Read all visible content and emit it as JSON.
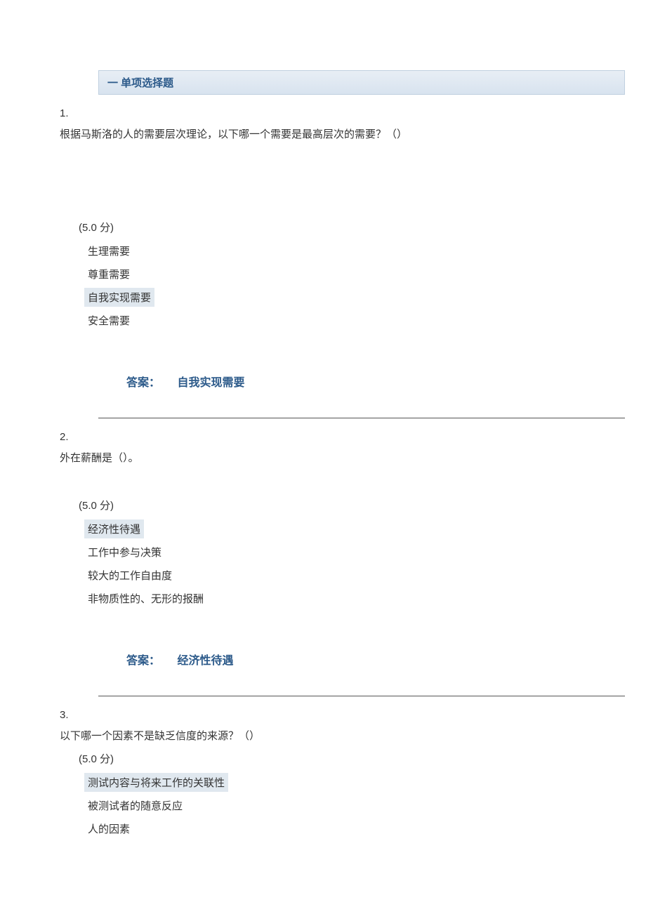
{
  "section_header": "一  单项选择题",
  "questions": [
    {
      "number": "1.",
      "text": "根据马斯洛的人的需要层次理论，以下哪一个需要是最高层次的需要？（）",
      "points": "(5.0  分)",
      "options": [
        {
          "text": "生理需要",
          "highlighted": false
        },
        {
          "text": "尊重需要",
          "highlighted": false
        },
        {
          "text": "自我实现需要",
          "highlighted": true
        },
        {
          "text": "安全需要",
          "highlighted": false
        }
      ],
      "answer_label": "答案：",
      "answer_value": "自我实现需要"
    },
    {
      "number": "2.",
      "text": "外在薪酬是（）。",
      "points": "(5.0  分)",
      "options": [
        {
          "text": "经济性待遇",
          "highlighted": true
        },
        {
          "text": "工作中参与决策",
          "highlighted": false
        },
        {
          "text": "较大的工作自由度",
          "highlighted": false
        },
        {
          "text": "非物质性的、无形的报酬",
          "highlighted": false
        }
      ],
      "answer_label": "答案：",
      "answer_value": "经济性待遇"
    },
    {
      "number": "3.",
      "text": "以下哪一个因素不是缺乏信度的来源？（）",
      "points": "(5.0  分)",
      "options": [
        {
          "text": "测试内容与将来工作的关联性",
          "highlighted": true
        },
        {
          "text": "被测试者的随意反应",
          "highlighted": false
        },
        {
          "text": "人的因素",
          "highlighted": false
        }
      ],
      "answer_label": "",
      "answer_value": ""
    }
  ]
}
